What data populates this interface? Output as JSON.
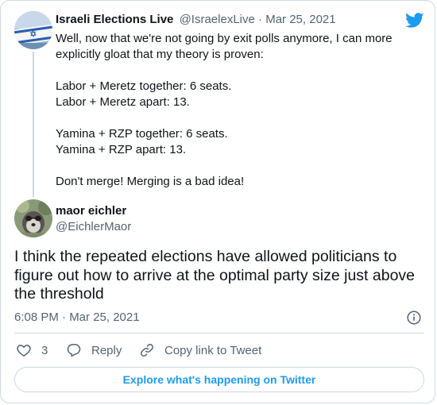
{
  "quoted_tweet": {
    "display_name": "Israeli Elections Live",
    "handle": "@IsraelexLive",
    "separator": " · ",
    "date": "Mar 25, 2021",
    "avatar_icon": "israeli-flag",
    "lines": [
      "Well, now that we're not going by exit polls anymore, I can more explicitly gloat that my theory is proven:",
      "",
      "Labor + Meretz together: 6 seats.",
      "Labor + Meretz apart: 13.",
      "",
      "Yamina + RZP together: 6 seats.",
      "Yamina + RZP apart: 13.",
      "",
      "Don't merge! Merging is a bad idea!"
    ]
  },
  "main_tweet": {
    "display_name": "maor eichler",
    "handle": "@EichlerMaor",
    "avatar_icon": "dog-photo",
    "text": "I think the repeated elections have allowed politicians to figure out how to arrive at the optimal party size just above the threshold",
    "timestamp": "6:08 PM · Mar 25, 2021"
  },
  "actions": {
    "like_count": "3",
    "reply_label": "Reply",
    "copy_link_label": "Copy link to Tweet"
  },
  "explore_label": "Explore what's happening on Twitter",
  "colors": {
    "accent": "#1d9bf0",
    "text": "#0f1419",
    "muted": "#536471",
    "border": "#cfd9de"
  },
  "icons": {
    "brand": "twitter-bird-icon",
    "info": "info-icon",
    "like": "heart-icon",
    "reply": "reply-bubble-icon",
    "copy": "link-icon"
  }
}
